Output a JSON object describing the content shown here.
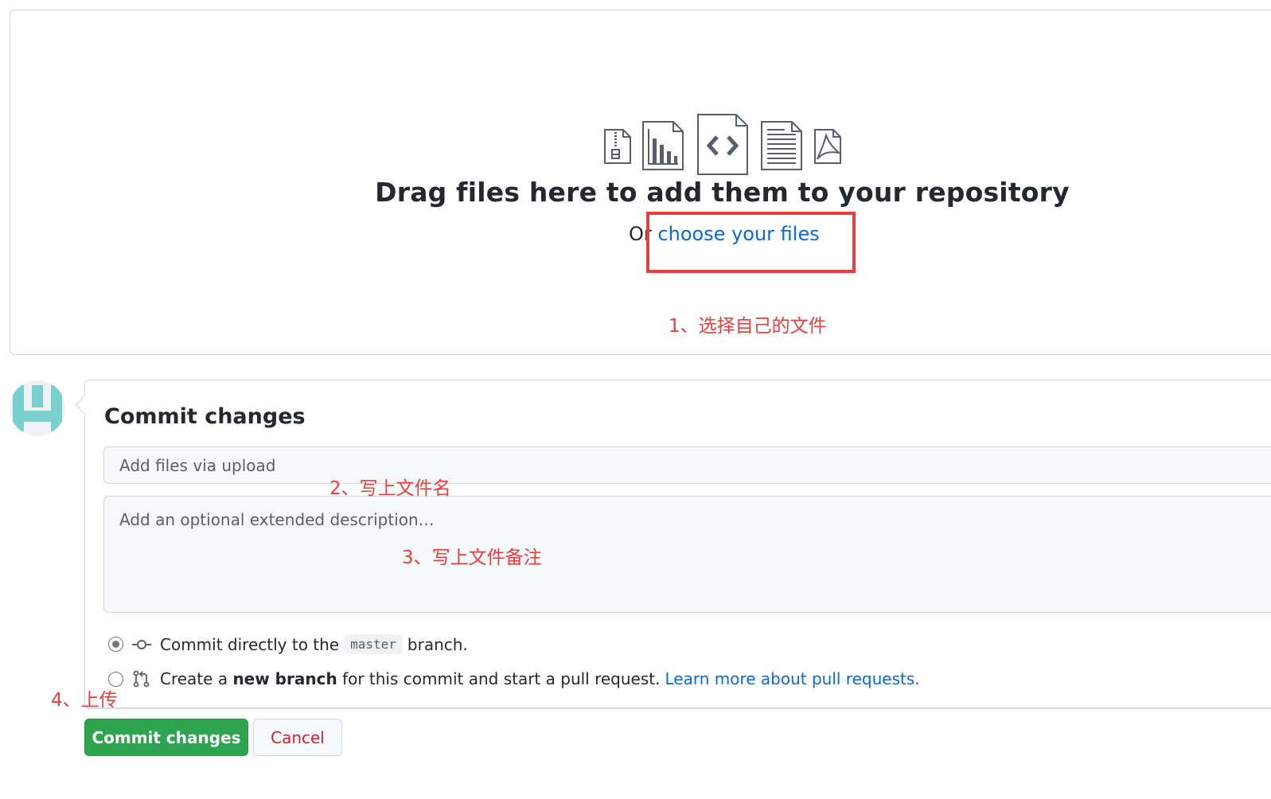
{
  "dropzone": {
    "icons": [
      "zip-file-icon",
      "chart-file-icon",
      "code-file-icon",
      "text-file-icon",
      "pdf-file-icon"
    ],
    "title": "Drag files here to add them to your repository",
    "choose_prefix": "Or",
    "choose_link": "choose your files"
  },
  "annotations": {
    "step1": "1、选择自己的文件",
    "step2": "2、写上文件名",
    "step3": "3、写上文件备注",
    "step4": "4、上传"
  },
  "commit": {
    "title": "Commit changes",
    "summary_placeholder": "Add files via upload",
    "description_placeholder": "Add an optional extended description…",
    "option_direct": {
      "before": "Commit directly to the",
      "branch": "master",
      "after": "branch.",
      "selected": true
    },
    "option_new_branch": {
      "before": "Create a",
      "bold": "new branch",
      "after": "for this commit and start a pull request.",
      "link": "Learn more about pull requests.",
      "selected": false
    },
    "submit_label": "Commit changes",
    "cancel_label": "Cancel"
  },
  "colors": {
    "accent_link": "#0969da",
    "primary_button": "#2da44e",
    "cancel_text": "#cf222e",
    "annotation_red": "#ee3b3b",
    "avatar_teal": "#7ccfcf"
  }
}
